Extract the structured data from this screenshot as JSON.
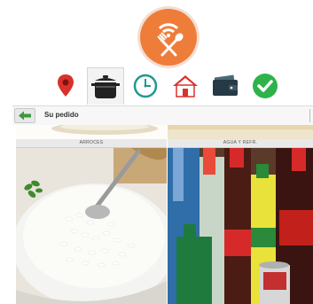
{
  "logo": {
    "icon": "restaurant-wifi-logo-icon",
    "color": "#ef7d3a"
  },
  "steps": [
    {
      "icon": "location-pin-icon",
      "active": false
    },
    {
      "icon": "cooking-pot-icon",
      "active": true
    },
    {
      "icon": "clock-icon",
      "active": false
    },
    {
      "icon": "home-icon",
      "active": false
    },
    {
      "icon": "wallet-icon",
      "active": false
    },
    {
      "icon": "check-circle-icon",
      "active": false
    }
  ],
  "toolbar": {
    "back_icon": "back-arrow-icon",
    "title": "Su pedido"
  },
  "categories": [
    {
      "label": "ARROCES",
      "image": "rice-bowl-photo"
    },
    {
      "label": "AGUA Y REFR.",
      "image": "soft-drinks-photo"
    }
  ]
}
